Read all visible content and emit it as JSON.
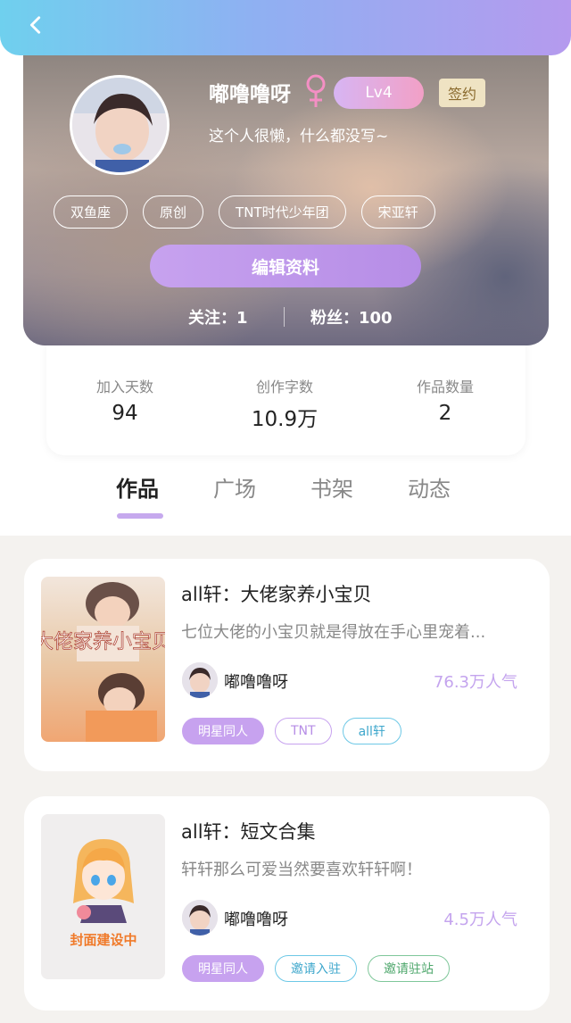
{
  "profile": {
    "username": "嘟噜噜呀",
    "gender_symbol": "♀",
    "level": "Lv4",
    "sign_badge": "签约",
    "bio": "这个人很懒，什么都没写~",
    "tags": [
      "双鱼座",
      "原创",
      "TNT时代少年团",
      "宋亚轩"
    ],
    "edit_label": "编辑资料",
    "follow_text": "关注：1",
    "fans_text": "粉丝：100"
  },
  "stats": [
    {
      "label": "加入天数",
      "value": "94"
    },
    {
      "label": "创作字数",
      "value": "10.9万"
    },
    {
      "label": "作品数量",
      "value": "2"
    }
  ],
  "tabs": [
    "作品",
    "广场",
    "书架",
    "动态"
  ],
  "active_tab": "作品",
  "books": [
    {
      "title": "all轩：大佬家养小宝贝",
      "desc": "七位大佬的小宝贝就是得放在手心里宠着...",
      "author": "嘟噜噜呀",
      "popularity": "76.3万人气",
      "cover_text": "大佬家养小宝贝",
      "tags": [
        "明星同人",
        "TNT",
        "all轩"
      ]
    },
    {
      "title": "all轩：短文合集",
      "desc": "轩轩那么可爱当然要喜欢轩轩啊！",
      "author": "嘟噜噜呀",
      "popularity": "4.5万人气",
      "cover_text": "封面建设中",
      "tags": [
        "明星同人",
        "邀请入驻",
        "邀请驻站"
      ]
    }
  ],
  "colors": {
    "accent": "#c7a2ef",
    "popularity": "#c4a4ee",
    "topbar_start": "#6fd0ee",
    "topbar_end": "#b59aee"
  }
}
